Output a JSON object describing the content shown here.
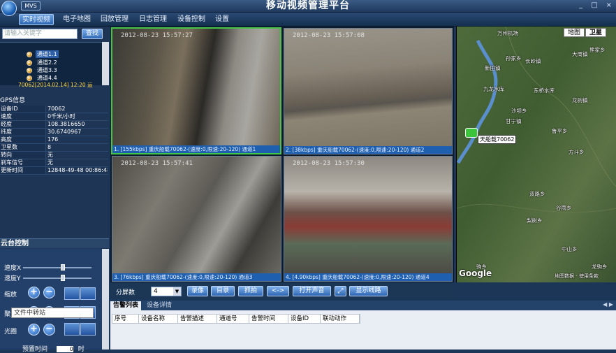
{
  "app": {
    "badge": "MVS",
    "title": "移动视频管理平台",
    "window_buttons": [
      "_",
      "□",
      "×"
    ]
  },
  "menu": [
    {
      "label": "实时视频",
      "active": true
    },
    {
      "label": "电子地图",
      "active": false
    },
    {
      "label": "回放管理",
      "active": false
    },
    {
      "label": "日志管理",
      "active": false
    },
    {
      "label": "设备控制",
      "active": false
    },
    {
      "label": "设置",
      "active": false
    }
  ],
  "search": {
    "placeholder": "请输入关键字",
    "button": "查找"
  },
  "tree": {
    "items": [
      "通道1.1",
      "通道2.2",
      "通道3.3",
      "通道4.4",
      "70062[2014.02.14] 12:20 运"
    ]
  },
  "gps": {
    "title": "GPS信息",
    "rows": [
      {
        "k": "设备ID",
        "v": "70062"
      },
      {
        "k": "速度",
        "v": "0千米/小时"
      },
      {
        "k": "经度",
        "v": "108.3816650"
      },
      {
        "k": "纬度",
        "v": "30.6740967"
      },
      {
        "k": "高度",
        "v": "176"
      },
      {
        "k": "卫星数",
        "v": "8"
      },
      {
        "k": "转向",
        "v": "无"
      },
      {
        "k": "刹车信号",
        "v": "无"
      },
      {
        "k": "更新时间",
        "v": "12848-49-48 00:86:48"
      }
    ]
  },
  "ptz": {
    "title": "云台控制",
    "speed_x": "速度X",
    "speed_y": "速度Y",
    "speed_x_level": 0.58,
    "speed_y_level": 0.58,
    "zoom": "缩放",
    "focus": "聚焦",
    "iris": "光圈",
    "plus": "+",
    "minus": "−",
    "tooltip": "文件中转站",
    "preset": "预置时间",
    "preset_value": "0",
    "preset_unit": "时"
  },
  "videos": [
    {
      "stamp": "2012-08-23 15:57:27",
      "status": "1. [155kbps] 重庆船载70062-(速度:0,限速:20-120) 通道1"
    },
    {
      "stamp": "2012-08-23 15:57:08",
      "status": "2. [38kbps] 重庆船载70062-(速度:0,限速:20-120) 通道2"
    },
    {
      "stamp": "2012-08-23 15:57:41",
      "status": "3. [76kbps] 重庆船载70062-(速度:0,限速:20-120) 通道3"
    },
    {
      "stamp": "2012-08-23 15:57:30",
      "status": "4. [4.90kbps] 重庆船载70062-(速度:0,限速:20-120) 通道4"
    }
  ],
  "controls": {
    "split_label": "分屏数",
    "split_value": "4",
    "buttons": [
      "录像",
      "目录",
      "抓拍",
      "<->",
      "打开声音",
      "显示线路"
    ]
  },
  "map": {
    "tabs": [
      "地图",
      "卫星"
    ],
    "vehicle": "天船载70062",
    "labels": [
      "万州机场",
      "新田镇",
      "长岭镇",
      "大周镇",
      "九龙水库",
      "东桥水库",
      "沙坝乡",
      "甘宁镇",
      "鲁平乡",
      "龙驹镇",
      "方斗乡",
      "双路乡",
      "谷雨乡",
      "中山乡",
      "梨树乡",
      "熊家乡",
      "孙家乡",
      "驹乡",
      "龙驹乡"
    ],
    "google": "Google",
    "copyright": "地图数据 - 使用条款"
  },
  "alarm": {
    "tabs": [
      "告警列表",
      "设备详情"
    ],
    "columns": [
      "序号",
      "设备名称",
      "告警描述",
      "通道号",
      "告警时间",
      "设备ID",
      "联动动作"
    ]
  }
}
